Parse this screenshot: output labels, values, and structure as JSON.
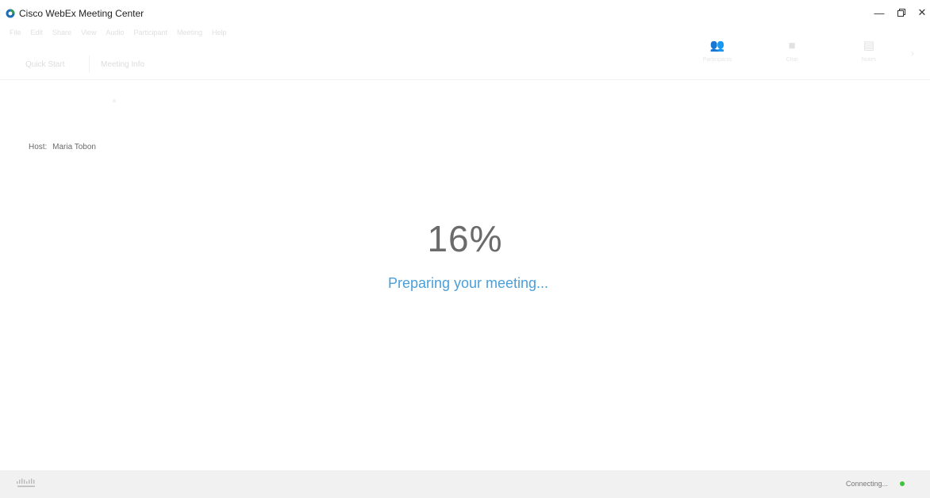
{
  "window": {
    "title": "Cisco WebEx Meeting Center",
    "minimize_icon": "minimize-icon",
    "restore_icon": "restore-icon",
    "close_icon": "close-icon"
  },
  "menu": {
    "items": [
      "File",
      "Edit",
      "Share",
      "View",
      "Audio",
      "Participant",
      "Meeting",
      "Help"
    ]
  },
  "tabs": [
    {
      "label": "Quick Start"
    },
    {
      "label": "Meeting Info"
    }
  ],
  "toolbar": {
    "participants": {
      "label": "Participants",
      "icon": "participants-icon"
    },
    "chat": {
      "label": "Chat",
      "icon": "chat-icon"
    },
    "notes": {
      "label": "Notes",
      "icon": "notes-icon"
    },
    "more_icon": "chevron-icon"
  },
  "host": {
    "label": "Host:",
    "name": "Maria Tobon"
  },
  "progress": {
    "value_percent": 16,
    "text": "16%",
    "status": "Preparing your meeting..."
  },
  "status_bar": {
    "logo": "cisco-logo",
    "connection_text": "Connecting...",
    "connection_color": "#3cc43c"
  },
  "colors": {
    "accent": "#4a9fd8",
    "logo_green": "#2e9e4a",
    "logo_blue": "#1f6fb5"
  }
}
